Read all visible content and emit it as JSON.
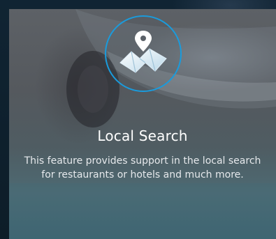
{
  "feature": {
    "title": "Local Search",
    "description": "This feature provides support in the local search for restaurants or hotels and much more.",
    "icon": "map-pin-icon"
  },
  "colors": {
    "accent": "#1a9bdc",
    "title_text": "#ffffff",
    "body_text": "#e6e9ec"
  }
}
